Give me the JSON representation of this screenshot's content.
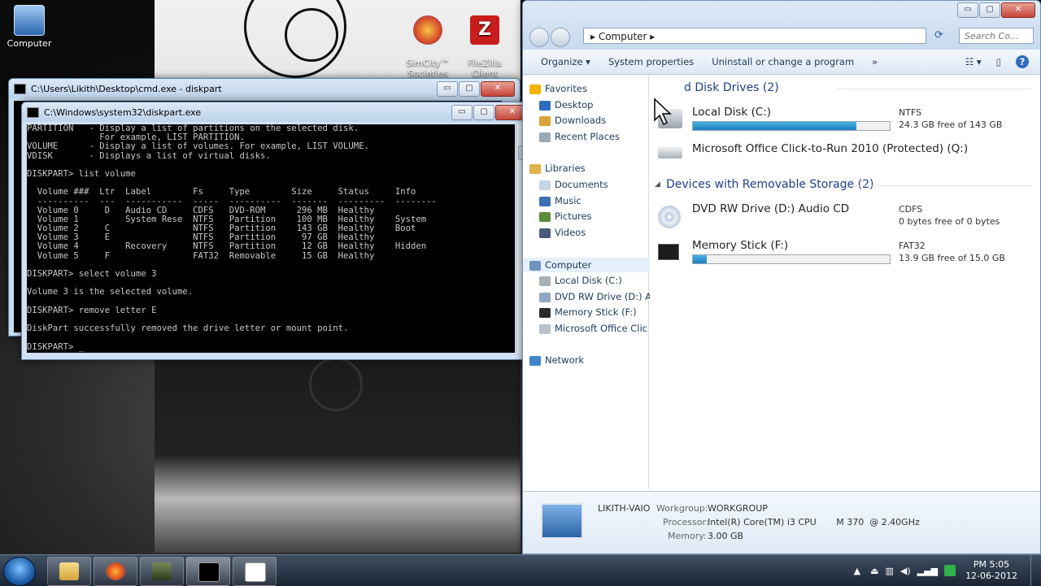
{
  "desktop": {
    "icons": [
      {
        "label": "Computer"
      },
      {
        "label": "SimCity™\nSocieties"
      },
      {
        "label": "FileZilla\nClient"
      }
    ]
  },
  "cmd_back": {
    "title": "C:\\Users\\Likith\\Desktop\\cmd.exe - diskpart",
    "min": "▭",
    "max": "▢",
    "close": "✕"
  },
  "cmd_front": {
    "title": "C:\\Windows\\system32\\diskpart.exe",
    "min": "▭",
    "max": "▢",
    "close": "✕",
    "console_lines": [
      "PARTITION   - Display a list of partitions on the selected disk.",
      "              For example, LIST PARTITION.",
      "VOLUME      - Display a list of volumes. For example, LIST VOLUME.",
      "VDISK       - Displays a list of virtual disks.",
      "",
      "DISKPART> list volume",
      "",
      "  Volume ###  Ltr  Label        Fs     Type        Size     Status     Info",
      "  ----------  ---  -----------  -----  ----------  -------  ---------  --------",
      "  Volume 0     D   Audio CD     CDFS   DVD-ROM      296 MB  Healthy",
      "  Volume 1         System Rese  NTFS   Partition    100 MB  Healthy    System",
      "  Volume 2     C                NTFS   Partition    143 GB  Healthy    Boot",
      "  Volume 3     E                NTFS   Partition     97 GB  Healthy",
      "  Volume 4         Recovery     NTFS   Partition     12 GB  Healthy    Hidden",
      "  Volume 5     F                FAT32  Removable     15 GB  Healthy",
      "",
      "DISKPART> select volume 3",
      "",
      "Volume 3 is the selected volume.",
      "",
      "DISKPART> remove letter E",
      "",
      "DiskPart successfully removed the drive letter or mount point.",
      "",
      "DISKPART> _"
    ]
  },
  "explorer": {
    "min": "▭",
    "max": "▢",
    "close": "✕",
    "address": "▸  Computer  ▸",
    "search_placeholder": "Search Co...",
    "toolbar": {
      "organize": "Organize ▾",
      "system_properties": "System properties",
      "uninstall": "Uninstall or change a program",
      "more": "»"
    },
    "nav": [
      {
        "label": "Favorites",
        "icon": "star-icon",
        "color": "#f2b400"
      },
      {
        "label": "Desktop",
        "icon": "desktop-icon",
        "color": "#2e6cc0"
      },
      {
        "label": "Downloads",
        "icon": "downloads-icon",
        "color": "#d8a33a"
      },
      {
        "label": "Recent Places",
        "icon": "recent-places-icon",
        "color": "#9aa9b8"
      },
      {
        "label": "Libraries",
        "icon": "libraries-icon",
        "color": "#e1b24a"
      },
      {
        "label": "Documents",
        "icon": "documents-icon",
        "color": "#c7d4e3"
      },
      {
        "label": "Music",
        "icon": "music-icon",
        "color": "#3d6fb8"
      },
      {
        "label": "Pictures",
        "icon": "pictures-icon",
        "color": "#5b8c3a"
      },
      {
        "label": "Videos",
        "icon": "videos-icon",
        "color": "#4b5a7a"
      },
      {
        "label": "Computer",
        "icon": "computer-icon",
        "color": "#6f92bf"
      },
      {
        "label": "Local Disk (C:)",
        "icon": "disk-icon",
        "color": "#a8b0b8"
      },
      {
        "label": "DVD RW Drive (D:) A",
        "icon": "dvd-icon",
        "color": "#8fa7c0"
      },
      {
        "label": "Memory Stick (F:)",
        "icon": "memory-stick-icon",
        "color": "#2a2a2a"
      },
      {
        "label": "Microsoft Office Clic",
        "icon": "office-drive-icon",
        "color": "#b9c0c8"
      },
      {
        "label": "Network",
        "icon": "network-icon",
        "color": "#3f86c9"
      }
    ],
    "groups": {
      "hard_disks": "d Disk Drives (2)",
      "removable": "Devices with Removable Storage (2)"
    },
    "drives": [
      {
        "name": "Local Disk (C:)",
        "fs": "NTFS",
        "free": "24.3 GB free of 143 GB",
        "used_fraction": 0.83,
        "has_bar": true
      },
      {
        "name": "Microsoft Office Click-to-Run 2010 (Protected) (Q:)",
        "fs": "",
        "free": "",
        "used_fraction": 0,
        "has_bar": false
      },
      {
        "name": "DVD RW Drive (D:) Audio CD",
        "fs": "CDFS",
        "free": "0 bytes free of 0 bytes",
        "used_fraction": 0,
        "has_bar": false
      },
      {
        "name": "Memory Stick (F:)",
        "fs": "FAT32",
        "free": "13.9 GB free of 15.0 GB",
        "used_fraction": 0.07,
        "has_bar": true
      }
    ],
    "details": {
      "pc_name": "LIKITH-VAIO",
      "workgroup_label": "Workgroup:",
      "workgroup": "WORKGROUP",
      "processor_label": "Processor:",
      "processor": "Intel(R) Core(TM) i3 CPU       M 370  @ 2.40GHz",
      "memory_label": "Memory:",
      "memory": "3.00 GB"
    }
  },
  "taskbar": {
    "clock_time": "PM 5:05",
    "clock_date": "12-06-2012",
    "tray_show_hidden": "▲"
  }
}
